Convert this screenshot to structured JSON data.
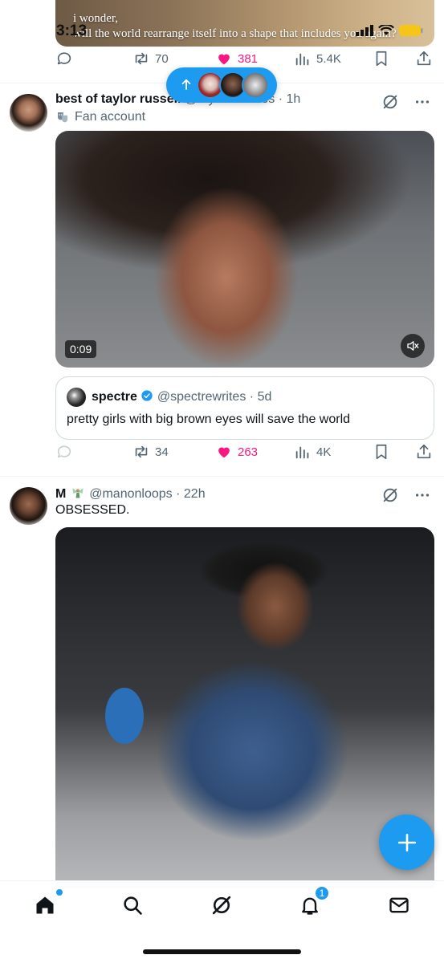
{
  "status_bar": {
    "time": "3:13"
  },
  "top_post": {
    "media_text_line1": "i wonder,",
    "media_text_line2": "will the world rearrange itself into a shape that includes you again?",
    "retweets": "70",
    "likes": "381",
    "views": "5.4K"
  },
  "new_posts_pill": {
    "icon": "arrow-up-icon"
  },
  "post1": {
    "display_name": "best of taylor russell",
    "handle": "@tayrussellfiles",
    "time": "1h",
    "label": "Fan account",
    "video_duration": "0:09",
    "quote": {
      "display_name": "spectre",
      "handle": "@spectrewrites",
      "time": "5d",
      "text": "pretty girls with big brown eyes will save the world"
    },
    "retweets": "34",
    "likes": "263",
    "views": "4K"
  },
  "post2": {
    "display_name": "M",
    "handle": "@manonloops",
    "time": "22h",
    "text": "OBSESSED."
  },
  "tabbar": {
    "notifications_badge": "1"
  },
  "colors": {
    "accent": "#1d9bf0",
    "like": "#f91880",
    "muted": "#536471"
  }
}
